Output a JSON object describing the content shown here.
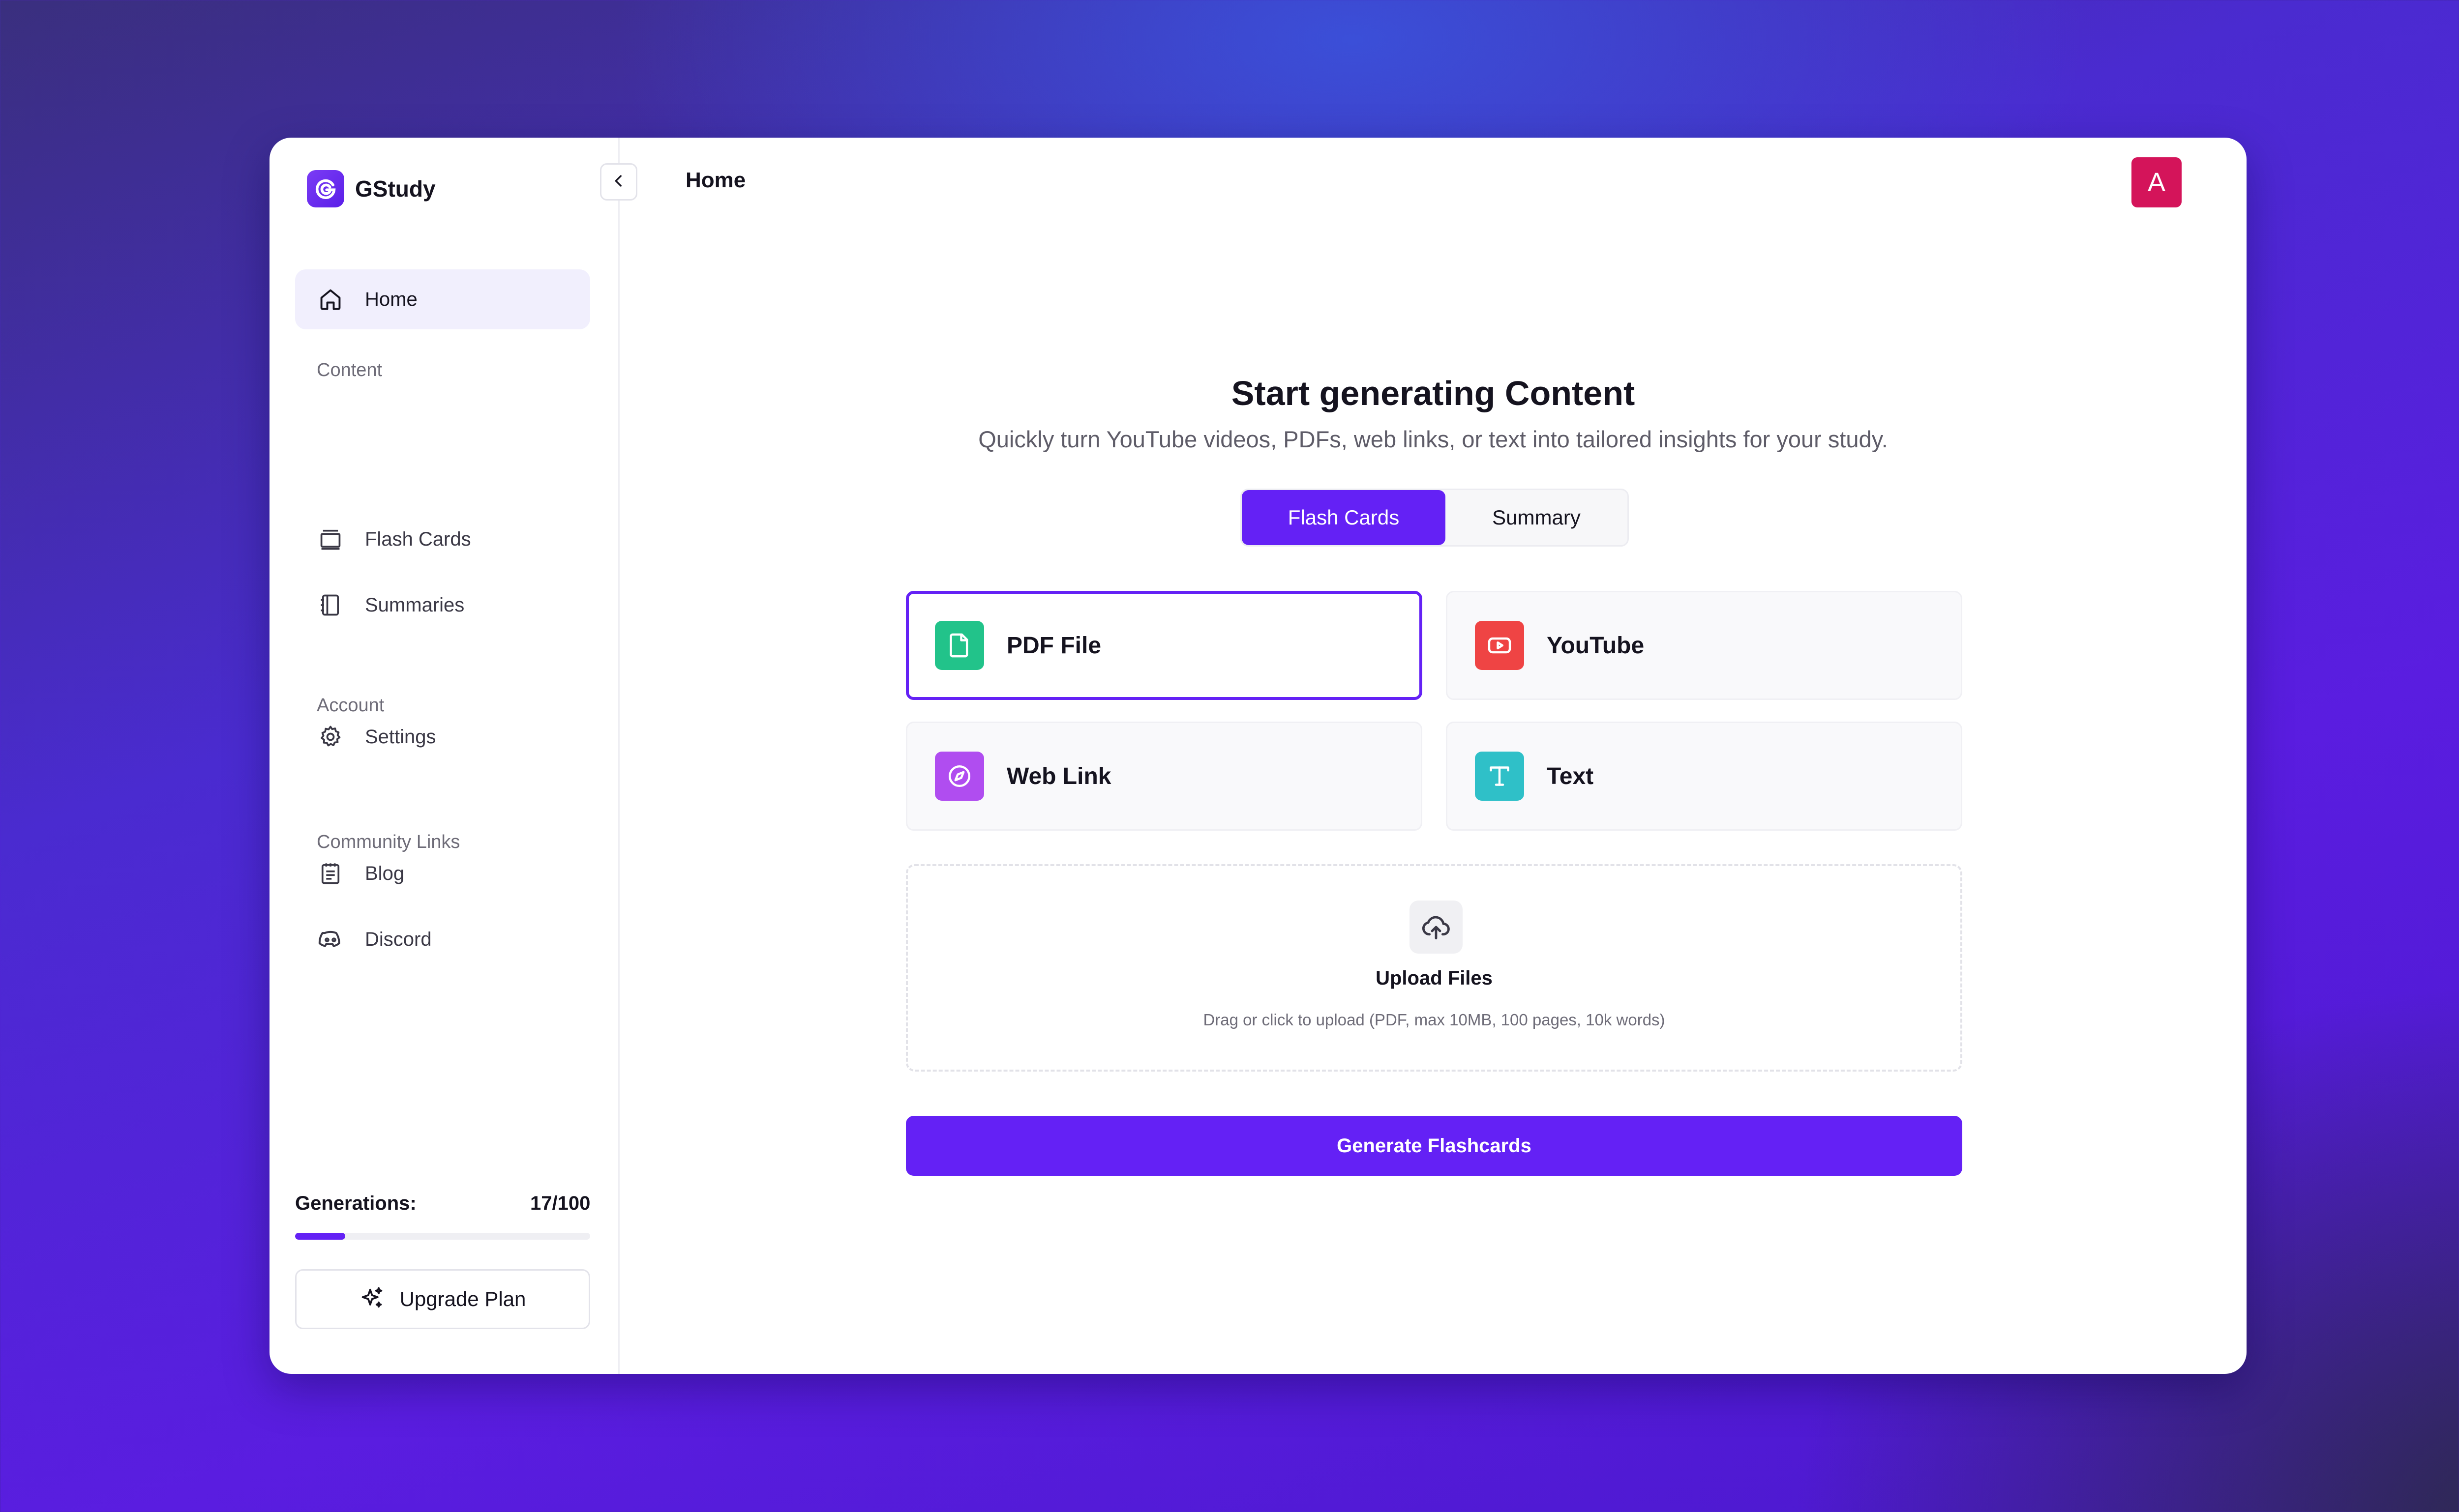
{
  "app": {
    "name": "GStudy"
  },
  "header": {
    "title": "Home",
    "avatar_initial": "A"
  },
  "sidebar": {
    "home": "Home",
    "sections": {
      "content": "Content",
      "account": "Account",
      "community": "Community Links"
    },
    "items": {
      "flash_cards": "Flash Cards",
      "summaries": "Summaries",
      "settings": "Settings",
      "blog": "Blog",
      "discord": "Discord"
    },
    "generations": {
      "label": "Generations:",
      "count": "17/100",
      "used": 17,
      "limit": 100
    },
    "upgrade_label": "Upgrade Plan"
  },
  "main": {
    "title": "Start generating Content",
    "subtitle": "Quickly turn YouTube videos, PDFs, web links, or text into tailored insights for your study.",
    "tabs": {
      "active": "Flash Cards",
      "inactive": "Summary"
    },
    "sources": {
      "pdf": "PDF File",
      "youtube": "YouTube",
      "weblink": "Web Link",
      "text": "Text"
    },
    "upload": {
      "title": "Upload Files",
      "hint": "Drag or click to upload (PDF, max 10MB, 100 pages, 10k words)"
    },
    "generate_label": "Generate Flashcards"
  },
  "colors": {
    "accent": "#6421f5",
    "pdf": "#22c38a",
    "youtube": "#ef4444",
    "weblink": "#b04df0",
    "text": "#2fc0c8",
    "avatar": "#d4145a"
  },
  "icons": {
    "logo": "gstudy-logo-icon",
    "collapse": "chevron-left-icon",
    "home": "home-icon",
    "flash_cards": "cards-icon",
    "summaries": "notebook-icon",
    "settings": "gear-icon",
    "blog": "notepad-icon",
    "discord": "discord-icon",
    "upgrade": "sparkles-icon",
    "pdf": "file-icon",
    "youtube": "youtube-icon",
    "weblink": "compass-icon",
    "text": "text-t-icon",
    "upload": "cloud-upload-icon"
  }
}
